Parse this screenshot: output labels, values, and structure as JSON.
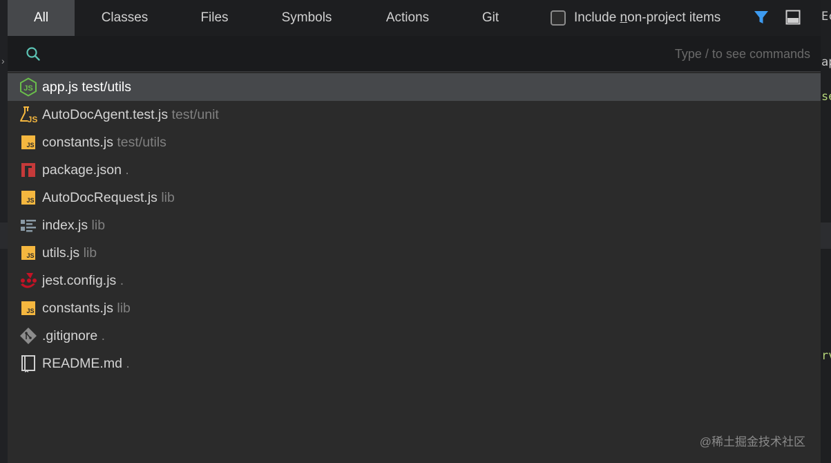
{
  "tabs": [
    {
      "label": "All",
      "active": true
    },
    {
      "label": "Classes"
    },
    {
      "label": "Files"
    },
    {
      "label": "Symbols"
    },
    {
      "label": "Actions"
    },
    {
      "label": "Git"
    }
  ],
  "include_option": {
    "before": "Include ",
    "mnemonic": "n",
    "after": "on-project items",
    "checked": false
  },
  "search": {
    "value": "",
    "hint": "Type / to see commands"
  },
  "results": [
    {
      "name": "app.js",
      "path": "test/utils",
      "icon": "node-js-icon",
      "selected": true
    },
    {
      "name": "AutoDocAgent.test.js",
      "path": "test/unit",
      "icon": "test-js-icon"
    },
    {
      "name": "constants.js",
      "path": "test/utils",
      "icon": "js-file-icon"
    },
    {
      "name": "package.json",
      "path": ".",
      "icon": "npm-icon"
    },
    {
      "name": "AutoDocRequest.js",
      "path": "lib",
      "icon": "js-file-icon"
    },
    {
      "name": "index.js",
      "path": "lib",
      "icon": "structure-list-icon"
    },
    {
      "name": "utils.js",
      "path": "lib",
      "icon": "js-file-icon"
    },
    {
      "name": "jest.config.js",
      "path": ".",
      "icon": "jest-icon"
    },
    {
      "name": "constants.js",
      "path": "lib",
      "icon": "js-file-icon"
    },
    {
      "name": ".gitignore",
      "path": ".",
      "icon": "git-diamond-icon"
    },
    {
      "name": "README.md",
      "path": ".",
      "icon": "markdown-book-icon"
    }
  ],
  "background_editor": {
    "right_fragments": [
      "Ec",
      "ap",
      "se",
      "rv"
    ]
  },
  "watermark": "@稀土掘金技术社区",
  "colors": {
    "accent_filter": "#3d9bf0",
    "js_badge": "#f5b73f",
    "node_green": "#6abf4b",
    "npm_red": "#c63a3a",
    "jest_red": "#c21325",
    "selection": "#46484b"
  }
}
